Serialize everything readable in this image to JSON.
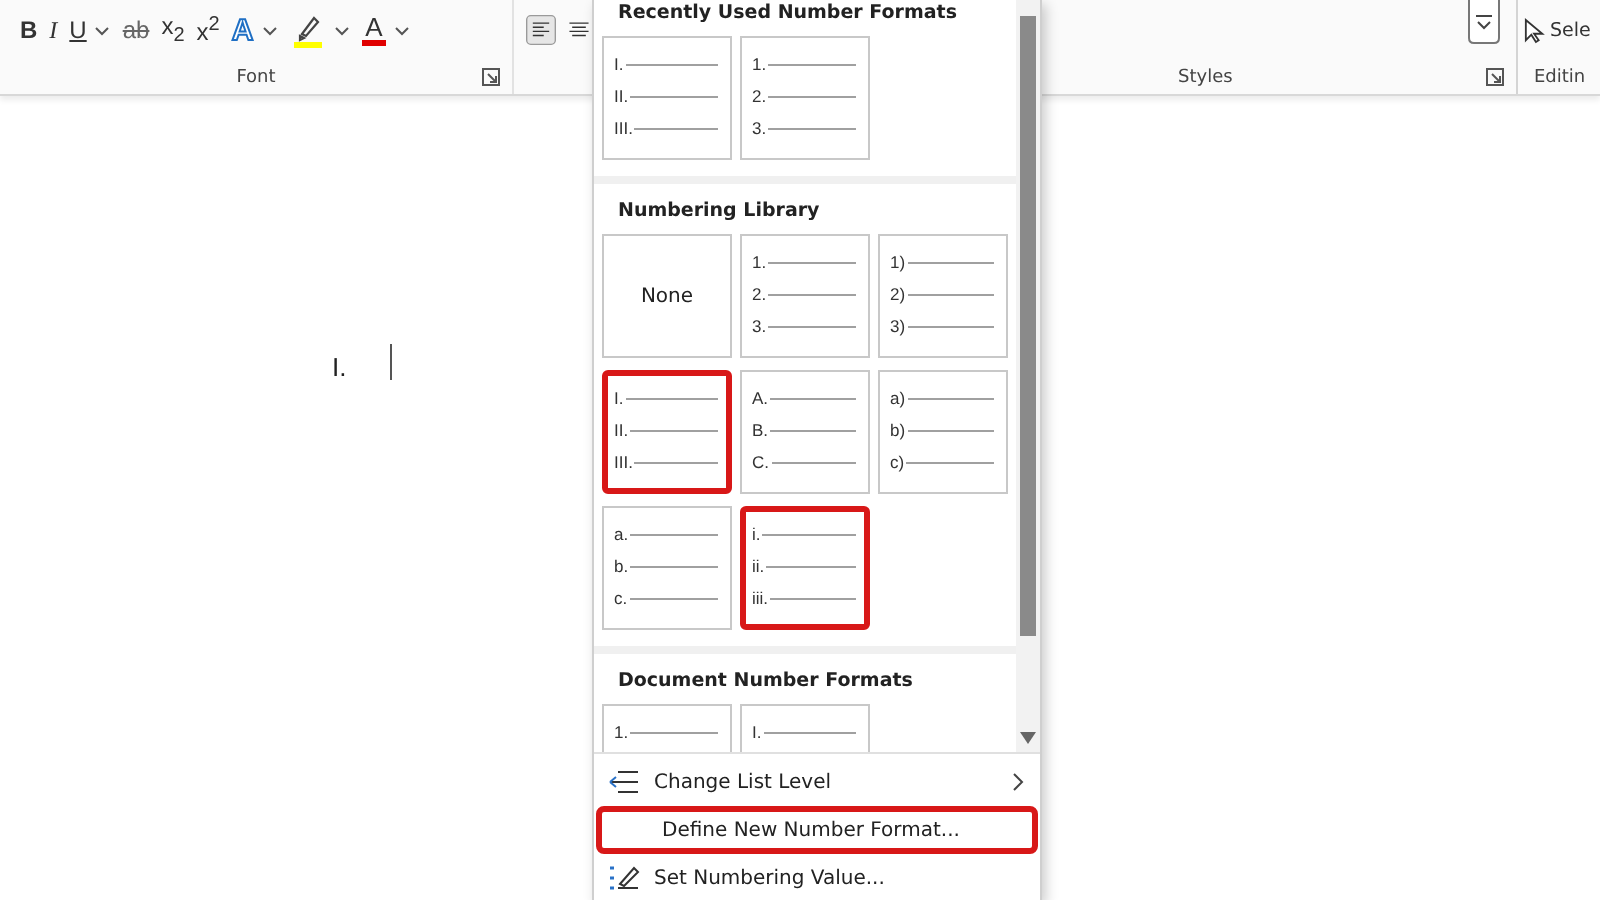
{
  "ribbon": {
    "font_group": {
      "label": "Font",
      "buttons": [
        {
          "kind": "bold",
          "label": "B",
          "dropdown": false
        },
        {
          "kind": "italic",
          "label": "I",
          "dropdown": false
        },
        {
          "kind": "underline",
          "label": "U",
          "dropdown": true
        },
        {
          "kind": "strikethrough",
          "label": "ab",
          "dropdown": false
        },
        {
          "kind": "subscript",
          "label": "x$_{2}$",
          "dropdown": false
        },
        {
          "kind": "superscript",
          "label": "x$^{2}$",
          "dropdown": false
        },
        {
          "kind": "text-effects",
          "label": "A",
          "dropdown": true
        },
        {
          "kind": "highlight",
          "color": "#ffff00",
          "dropdown": true
        },
        {
          "kind": "font-color",
          "label": "A",
          "color": "#e00000",
          "dropdown": true
        }
      ]
    },
    "paragraph_group": {
      "buttons": [
        {
          "kind": "align-left",
          "selected": true
        },
        {
          "kind": "align-center",
          "selected": false
        }
      ]
    },
    "styles_group": {
      "label": "Styles"
    },
    "editing_group": {
      "select": "Sele",
      "label": "Editin"
    }
  },
  "document": {
    "list_number": "I."
  },
  "menu": {
    "sections": [
      {
        "title": "Recently Used Number Formats",
        "tiles": [
          {
            "kind": "list",
            "labels": [
              "I.",
              "II.",
              "III."
            ],
            "highlighted": false
          },
          {
            "kind": "list",
            "labels": [
              "1.",
              "2.",
              "3."
            ],
            "highlighted": false
          }
        ]
      },
      {
        "title": "Numbering Library",
        "tiles": [
          {
            "kind": "none",
            "label": "None",
            "highlighted": false
          },
          {
            "kind": "list",
            "labels": [
              "1.",
              "2.",
              "3."
            ],
            "highlighted": false
          },
          {
            "kind": "list",
            "labels": [
              "1)",
              "2)",
              "3)"
            ],
            "highlighted": false
          },
          {
            "kind": "list",
            "labels": [
              "I.",
              "II.",
              "III."
            ],
            "highlighted": true
          },
          {
            "kind": "list",
            "labels": [
              "A.",
              "B.",
              "C."
            ],
            "highlighted": false
          },
          {
            "kind": "list",
            "labels": [
              "a)",
              "b)",
              "c)"
            ],
            "highlighted": false
          },
          {
            "kind": "list",
            "labels": [
              "a.",
              "b.",
              "c."
            ],
            "highlighted": false
          },
          {
            "kind": "list",
            "labels": [
              "i.",
              "ii.",
              "iii."
            ],
            "highlighted": true
          }
        ]
      },
      {
        "title": "Document Number Formats",
        "tiles": [
          {
            "kind": "list",
            "labels": [
              "1."
            ],
            "highlighted": false
          },
          {
            "kind": "list",
            "labels": [
              "I."
            ],
            "highlighted": false
          }
        ]
      }
    ],
    "items": [
      {
        "kind": "change-level",
        "label": "Change List Level",
        "submenu": true,
        "highlighted": false
      },
      {
        "kind": "define",
        "label": "Define New Number Format...",
        "submenu": false,
        "highlighted": true
      },
      {
        "kind": "set-value",
        "label": "Set Numbering Value...",
        "submenu": false,
        "highlighted": false
      }
    ]
  }
}
